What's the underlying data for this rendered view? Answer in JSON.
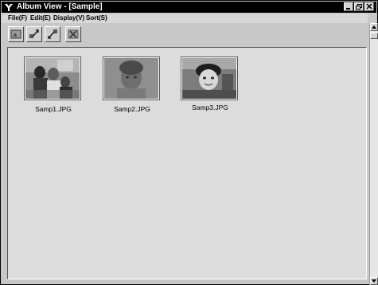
{
  "window": {
    "title": "Album View - [Sample]",
    "controls": [
      "minimize-icon",
      "restore-icon",
      "close-icon"
    ]
  },
  "menu": [
    {
      "label": "File(F)"
    },
    {
      "label": "Edit(E)"
    },
    {
      "label": "Display(V)"
    },
    {
      "label": "Sort(S)"
    }
  ],
  "toolbar": {
    "buttons": [
      {
        "icon": "album-icon"
      },
      {
        "icon": "rotate-left-icon"
      },
      {
        "icon": "rotate-right-icon"
      },
      {
        "icon": "delete-icon"
      }
    ]
  },
  "thumbnails": [
    {
      "filename": "Samp1.JPG"
    },
    {
      "filename": "Samp2.JPG"
    },
    {
      "filename": "Samp3.JPG"
    }
  ],
  "colors": {
    "titlebar": "#000000",
    "window_bg": "#c8c8c8",
    "content_bg": "#dcdcdc"
  }
}
